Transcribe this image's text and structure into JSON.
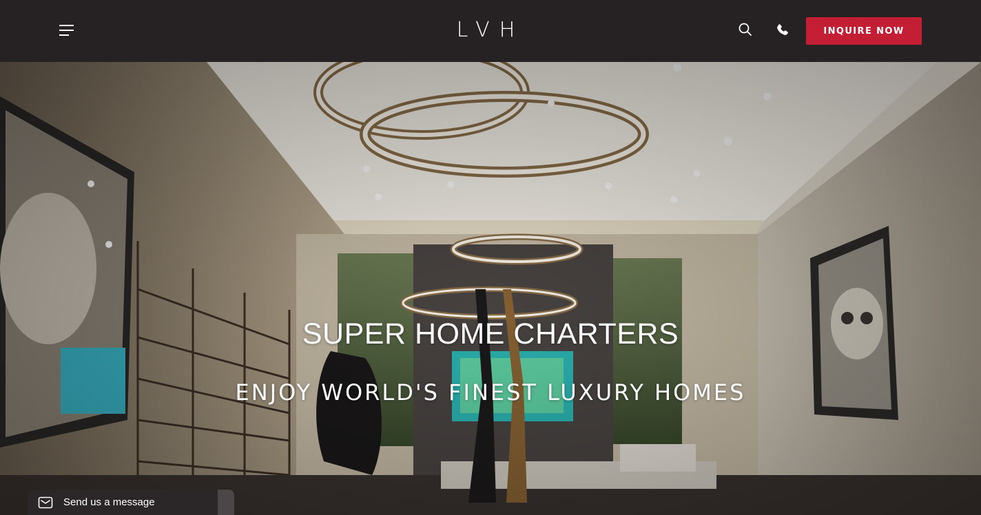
{
  "header": {
    "logo": "LVH",
    "menu_icon": "hamburger-menu-icon",
    "search_icon": "search-icon",
    "phone_icon": "phone-icon",
    "inquire_label": "INQUIRE NOW"
  },
  "hero": {
    "title": "SUPER HOME CHARTERS",
    "subtitle": "ENJOY WORLD'S FINEST LUXURY HOMES"
  },
  "message_widget": {
    "icon": "envelope-icon",
    "label": "Send us a message"
  },
  "colors": {
    "header_bg": "#262224",
    "accent": "#c41e34",
    "text": "#ffffff"
  }
}
